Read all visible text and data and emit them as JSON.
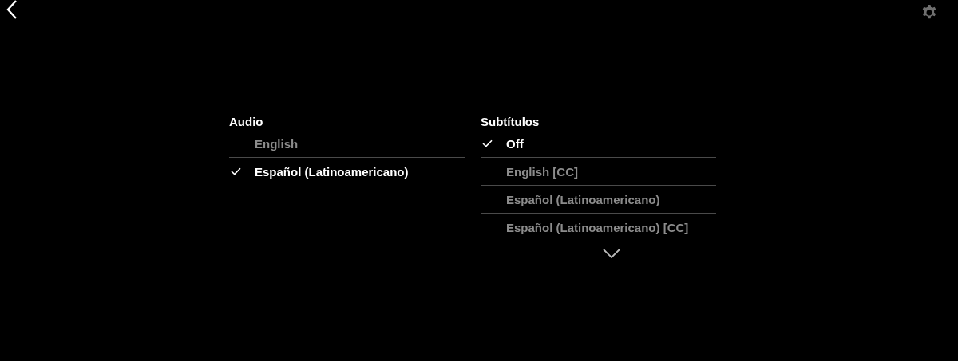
{
  "columns": [
    {
      "title": "Audio",
      "options": [
        {
          "label": "English",
          "selected": false
        },
        {
          "label": "Español (Latinoamericano)",
          "selected": true
        }
      ]
    },
    {
      "title": "Subtítulos",
      "options": [
        {
          "label": "Off",
          "selected": true
        },
        {
          "label": "English [CC]",
          "selected": false
        },
        {
          "label": "Español (Latinoamericano)",
          "selected": false
        },
        {
          "label": "Español (Latinoamericano) [CC]",
          "selected": false
        }
      ],
      "more_below": true
    }
  ]
}
